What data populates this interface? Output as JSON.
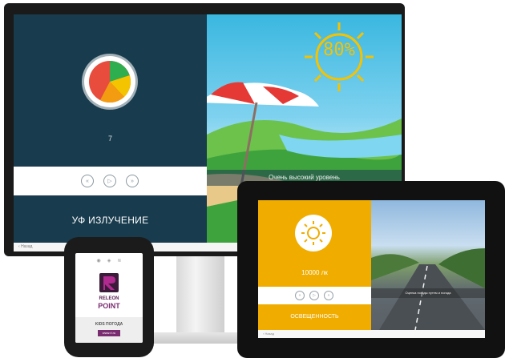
{
  "monitor": {
    "uv_value": "7",
    "uv_title": "УФ ИЗЛУЧЕНИЕ",
    "uv_percent": "80%",
    "uv_caption": "Очень высокий уровень",
    "back_label": "Назад",
    "controls": {
      "prev": "«",
      "play": "▷",
      "next": "»"
    }
  },
  "tablet": {
    "lux_value": "10000 лк",
    "lux_title": "ОСВЕЩЕННОСТЬ",
    "caption": "Оценка погоды путем и погода",
    "back_label": "Назад",
    "controls": {
      "prev": "«",
      "play": "▷",
      "next": "»"
    }
  },
  "device": {
    "brand_line1": "RELEON",
    "brand_line2": "POINT",
    "label": "KIDS ПОГОДА",
    "url": "www.rl.ru"
  },
  "colors": {
    "monitor_panel": "#183b4d",
    "tablet_panel": "#f0ad00",
    "brand": "#7a2c70"
  },
  "icons": [
    "back-arrow-icon",
    "prev-icon",
    "play-icon",
    "next-icon",
    "sun-icon",
    "uv-pie-icon"
  ]
}
